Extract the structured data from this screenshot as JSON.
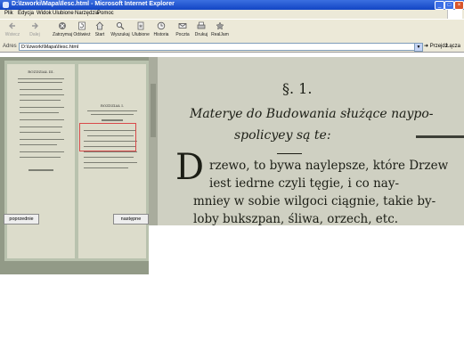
{
  "window": {
    "title": "D:\\Izworki\\Mapa\\Ilesc.html - Microsoft Internet Explorer",
    "controls": [
      "_",
      "□",
      "×"
    ]
  },
  "menubar": {
    "items": [
      "Plik",
      "Edycja",
      "Widok",
      "Ulubione",
      "Narzędzia",
      "Pomoc"
    ]
  },
  "toolbar": {
    "buttons": [
      {
        "label": "Wstecz",
        "icon": "back-arrow-icon",
        "enabled": false
      },
      {
        "label": "Dalej",
        "icon": "forward-arrow-icon",
        "enabled": false
      },
      {
        "label": "Zatrzymaj",
        "icon": "stop-icon",
        "enabled": true
      },
      {
        "label": "Odśwież",
        "icon": "refresh-icon",
        "enabled": true
      },
      {
        "label": "Start",
        "icon": "home-icon",
        "enabled": true
      },
      {
        "label": "Wyszukaj",
        "icon": "search-icon",
        "enabled": true
      },
      {
        "label": "Ulubione",
        "icon": "favorites-icon",
        "enabled": true
      },
      {
        "label": "Historia",
        "icon": "history-icon",
        "enabled": true
      },
      {
        "label": "Poczta",
        "icon": "mail-icon",
        "enabled": true
      },
      {
        "label": "Drukuj",
        "icon": "print-icon",
        "enabled": true
      },
      {
        "label": "RealJam",
        "icon": "realjam-icon",
        "enabled": true
      }
    ]
  },
  "addressbar": {
    "label": "Adres",
    "value": "D:\\Izworki\\Mapa\\Ilesc.html",
    "go_label": "Przejdź",
    "links_label": "Łącza"
  },
  "viewer": {
    "prev_label": "poprzednie",
    "next_label": "następne"
  },
  "thumbnail": {
    "left_heading": "ROZDZIAŁ III.",
    "right_heading": "ROZDZIAŁ I."
  },
  "scan": {
    "section": "§. 1.",
    "heading_line1": "Materye do Budowania służące naypo-",
    "heading_line2": "spolicyey są te:",
    "initial": "D",
    "body_line1": "rzewo, to bywa naylepsze, które Drzew",
    "body_line2": "iest iedrne czyli tęgie, i co nay-",
    "body_line3": "mniey w sobie wilgoci ciągnie, takie by-",
    "body_line4": "loby bukszpan, śliwa, orzech, etc."
  },
  "colors": {
    "titlebar": "#1245c4",
    "chrome": "#ece9d8",
    "scan_paper": "#cfd0c2",
    "thumb_frame": "#929a87",
    "highlight": "#d94a4a"
  }
}
